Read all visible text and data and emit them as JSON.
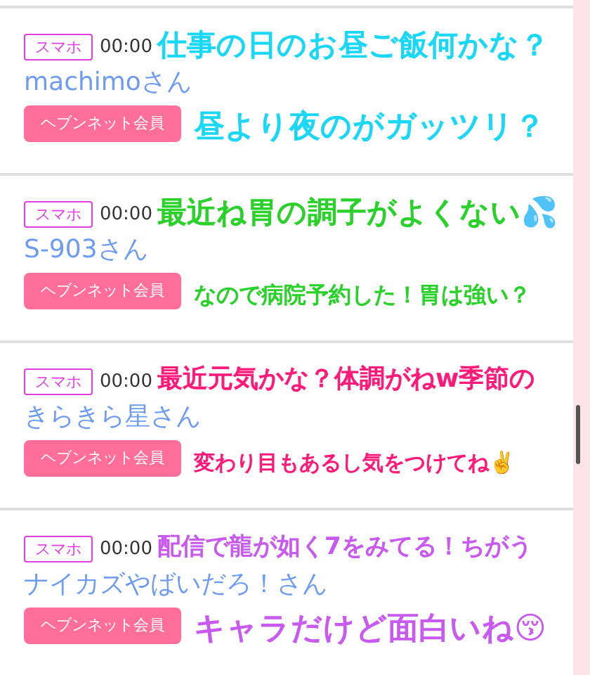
{
  "posts": [
    {
      "device": "スマホ",
      "time": "00:00",
      "name": "machimoさん",
      "member": "ヘブンネット会員",
      "caption": {
        "color": "#1ad8f5",
        "lines": [
          "仕事の日のお昼ご飯何かな？",
          "昼より夜のがガッツリ？"
        ]
      }
    },
    {
      "device": "スマホ",
      "time": "00:00",
      "name": "S-903さん",
      "member": "ヘブンネット会員",
      "caption": {
        "color": "#2bd12b",
        "lines": [
          "最近ね胃の調子がよくない💦",
          "なので病院予約した！胃は強い？"
        ]
      }
    },
    {
      "device": "スマホ",
      "time": "00:00",
      "name": "きらきら星さん",
      "member": "ヘブンネット会員",
      "caption": {
        "color": "#ff1a7a",
        "lines": [
          "最近元気かな？体調がねw季節の",
          "変わり目もあるし気をつけてね✌️"
        ]
      }
    },
    {
      "device": "スマホ",
      "time": "00:00",
      "name": "ナイカズやばいだろ！さん",
      "member": "ヘブンネット会員",
      "caption": {
        "color": "#c85af0",
        "lines": [
          "配信で龍が如く7をみてる！ちがう",
          "キャラだけど面白いね😚"
        ]
      }
    }
  ]
}
